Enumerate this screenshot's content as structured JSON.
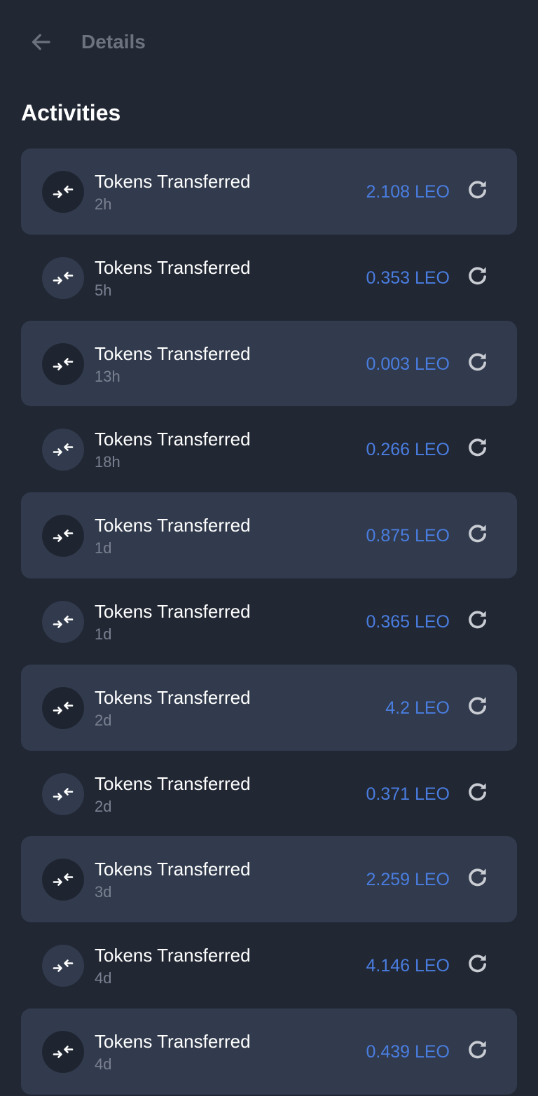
{
  "header": {
    "title": "Details",
    "back_icon": "arrow-left-icon"
  },
  "section": {
    "title": "Activities"
  },
  "colors": {
    "background": "#212733",
    "card": "#313b4d",
    "amount": "#4a7de0",
    "muted": "#7a8090"
  },
  "activities": [
    {
      "title": "Tokens Transferred",
      "time": "2h",
      "amount": "2.108 LEO"
    },
    {
      "title": "Tokens Transferred",
      "time": "5h",
      "amount": "0.353 LEO"
    },
    {
      "title": "Tokens Transferred",
      "time": "13h",
      "amount": "0.003 LEO"
    },
    {
      "title": "Tokens Transferred",
      "time": "18h",
      "amount": "0.266 LEO"
    },
    {
      "title": "Tokens Transferred",
      "time": "1d",
      "amount": "0.875 LEO"
    },
    {
      "title": "Tokens Transferred",
      "time": "1d",
      "amount": "0.365 LEO"
    },
    {
      "title": "Tokens Transferred",
      "time": "2d",
      "amount": "4.2 LEO"
    },
    {
      "title": "Tokens Transferred",
      "time": "2d",
      "amount": "0.371 LEO"
    },
    {
      "title": "Tokens Transferred",
      "time": "3d",
      "amount": "2.259 LEO"
    },
    {
      "title": "Tokens Transferred",
      "time": "4d",
      "amount": "4.146 LEO"
    },
    {
      "title": "Tokens Transferred",
      "time": "4d",
      "amount": "0.439 LEO"
    }
  ]
}
